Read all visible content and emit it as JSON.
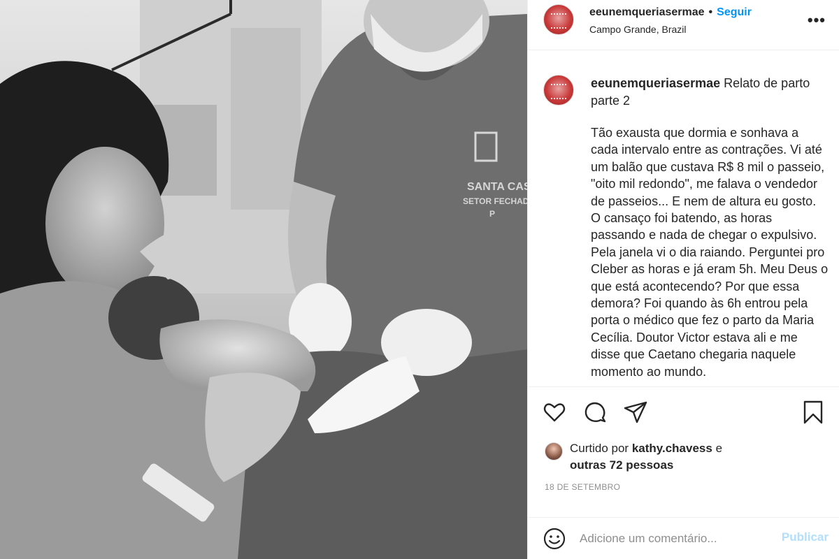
{
  "post": {
    "username": "eeunemqueriasermae",
    "separator": "•",
    "follow_label": "Seguir",
    "location": "Campo Grande, Brazil",
    "more_label": "•••"
  },
  "caption": {
    "username": "eeunemqueriasermae",
    "title": "Relato de parto parte 2",
    "body": "Tão exausta que dormia e sonhava a cada intervalo entre as contrações. Vi até um balão que custava R$ 8 mil o passeio, \"oito mil redondo\", me falava o vendedor de passeios... E nem de altura eu gosto. O cansaço foi batendo, as horas passando e nada de chegar o expulsivo. Pela janela vi o dia raiando. Perguntei pro Cleber as horas e já eram 5h. Meu Deus o que está acontecendo? Por que essa demora? Foi quando às 6h entrou pela porta o médico que fez o parto da Maria Cecília. Doutor Victor estava ali e me disse que Caetano chegaria naquele momento ao mundo."
  },
  "photo": {
    "scrubs_text_1": "SANTA CASA",
    "scrubs_text_2": "SETOR FECHADO",
    "scrubs_text_3": "P"
  },
  "likes": {
    "prefix": "Curtido por",
    "user": "kathy.chavess",
    "conj": "e",
    "others": "outras 72 pessoas"
  },
  "date": "18 DE SETEMBRO",
  "comment": {
    "placeholder": "Adicione um comentário...",
    "publish_label": "Publicar"
  },
  "icons": [
    "heart-icon",
    "comment-icon",
    "share-icon",
    "bookmark-icon",
    "emoji-icon"
  ],
  "colors": {
    "accent": "#0095f6",
    "publish_disabled": "#b2dffc",
    "text": "#262626",
    "muted": "#8e8e8e",
    "border": "#efefef"
  }
}
